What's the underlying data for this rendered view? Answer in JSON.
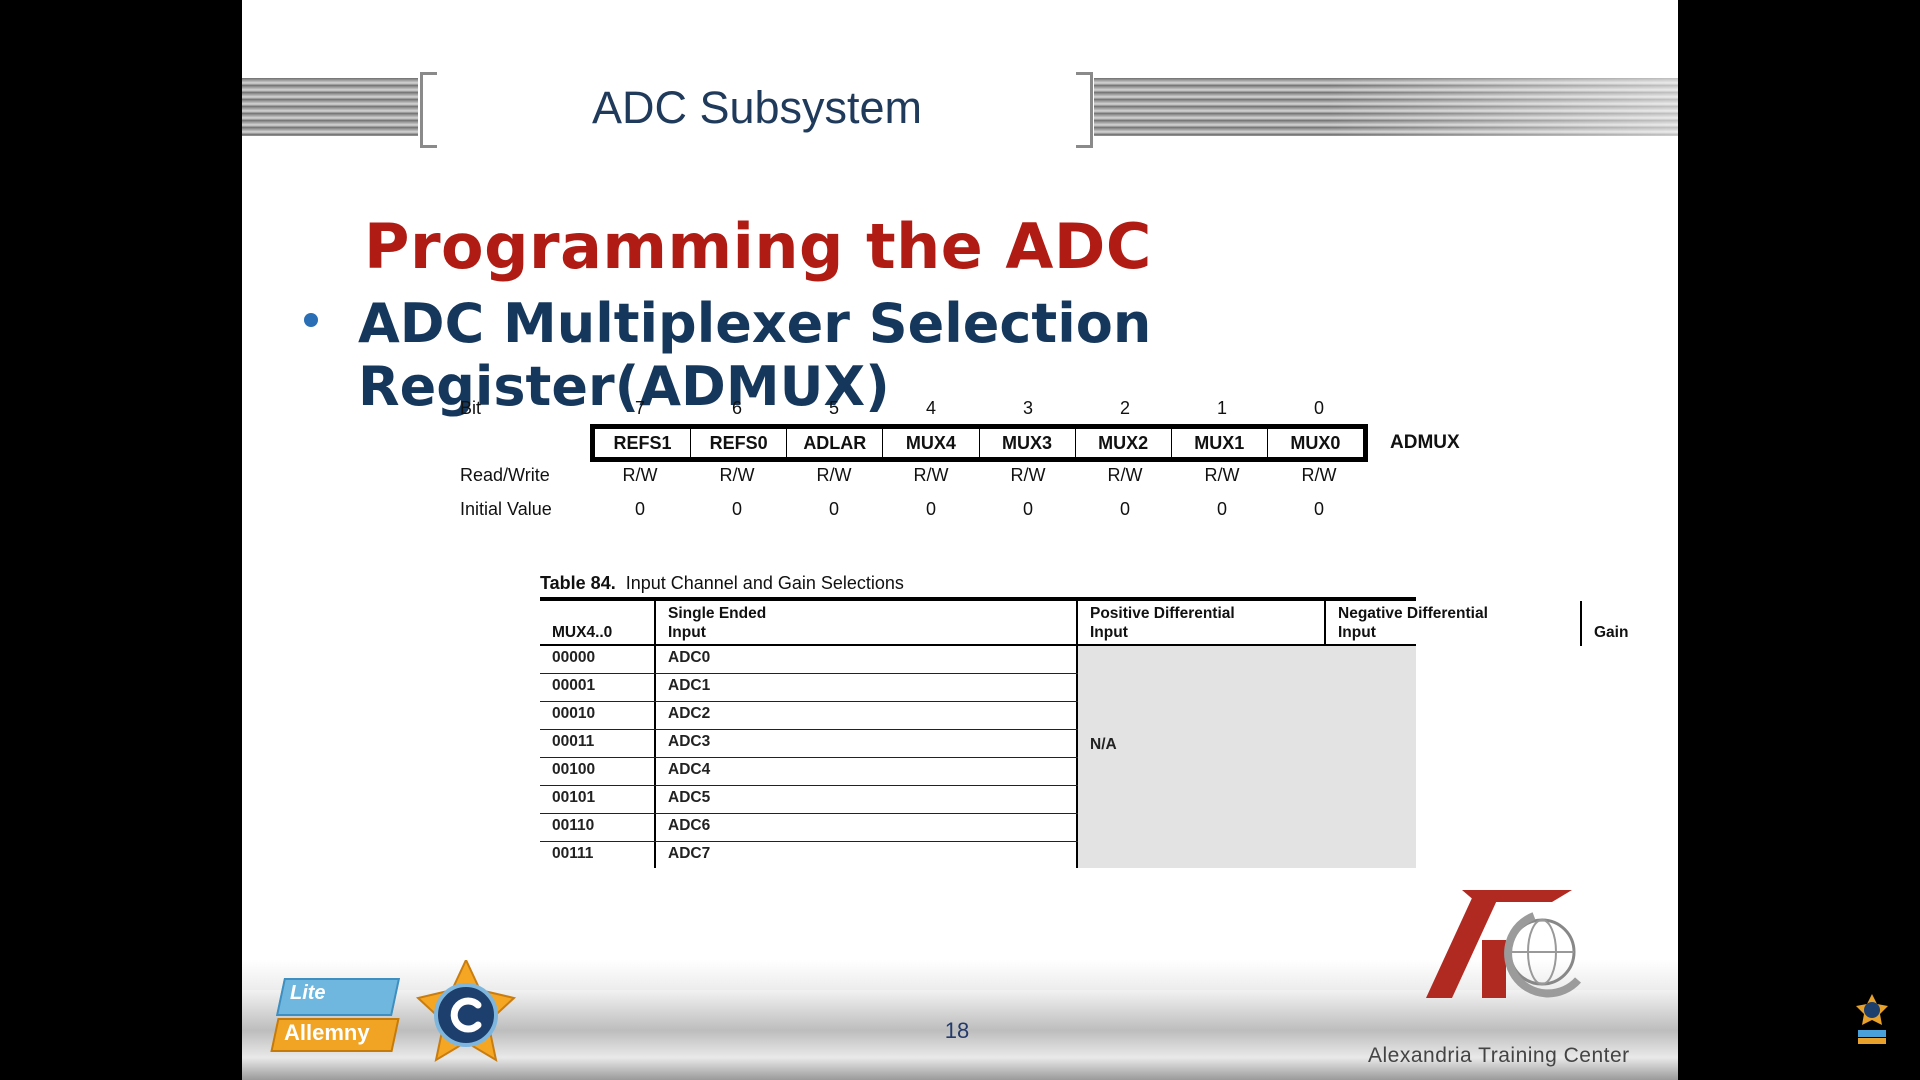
{
  "slide": {
    "title": "ADC Subsystem",
    "heading": "Programming the ADC",
    "bullet": "ADC Multiplexer Selection Register(ADMUX)",
    "page_number": "18",
    "footer_org": "Alexandria Training Center",
    "footer_brand_top": "Lite",
    "footer_brand_bottom": "Allemny"
  },
  "register": {
    "name": "ADMUX",
    "labels": {
      "bit": "Bit",
      "rw": "Read/Write",
      "init": "Initial Value"
    },
    "bits": [
      {
        "num": "7",
        "field": "REFS1",
        "rw": "R/W",
        "init": "0"
      },
      {
        "num": "6",
        "field": "REFS0",
        "rw": "R/W",
        "init": "0"
      },
      {
        "num": "5",
        "field": "ADLAR",
        "rw": "R/W",
        "init": "0"
      },
      {
        "num": "4",
        "field": "MUX4",
        "rw": "R/W",
        "init": "0"
      },
      {
        "num": "3",
        "field": "MUX3",
        "rw": "R/W",
        "init": "0"
      },
      {
        "num": "2",
        "field": "MUX2",
        "rw": "R/W",
        "init": "0"
      },
      {
        "num": "1",
        "field": "MUX1",
        "rw": "R/W",
        "init": "0"
      },
      {
        "num": "0",
        "field": "MUX0",
        "rw": "R/W",
        "init": "0"
      }
    ]
  },
  "table": {
    "caption_num": "Table 84.",
    "caption_text": "Input Channel and Gain Selections",
    "headers": {
      "mux": "MUX4..0",
      "single_1": "Single Ended",
      "single_2": "Input",
      "pos_1": "Positive Differential",
      "pos_2": "Input",
      "neg_1": "Negative Differential",
      "neg_2": "Input",
      "gain": "Gain"
    },
    "rows": [
      {
        "mux": "00000",
        "input": "ADC0"
      },
      {
        "mux": "00001",
        "input": "ADC1"
      },
      {
        "mux": "00010",
        "input": "ADC2"
      },
      {
        "mux": "00011",
        "input": "ADC3"
      },
      {
        "mux": "00100",
        "input": "ADC4"
      },
      {
        "mux": "00101",
        "input": "ADC5"
      },
      {
        "mux": "00110",
        "input": "ADC6"
      },
      {
        "mux": "00111",
        "input": "ADC7"
      }
    ],
    "na": "N/A"
  },
  "colors": {
    "heading": "#b01c14",
    "bullet_text": "#16375c",
    "title": "#1f3a5a",
    "table_shade": "#e3e3e3"
  }
}
